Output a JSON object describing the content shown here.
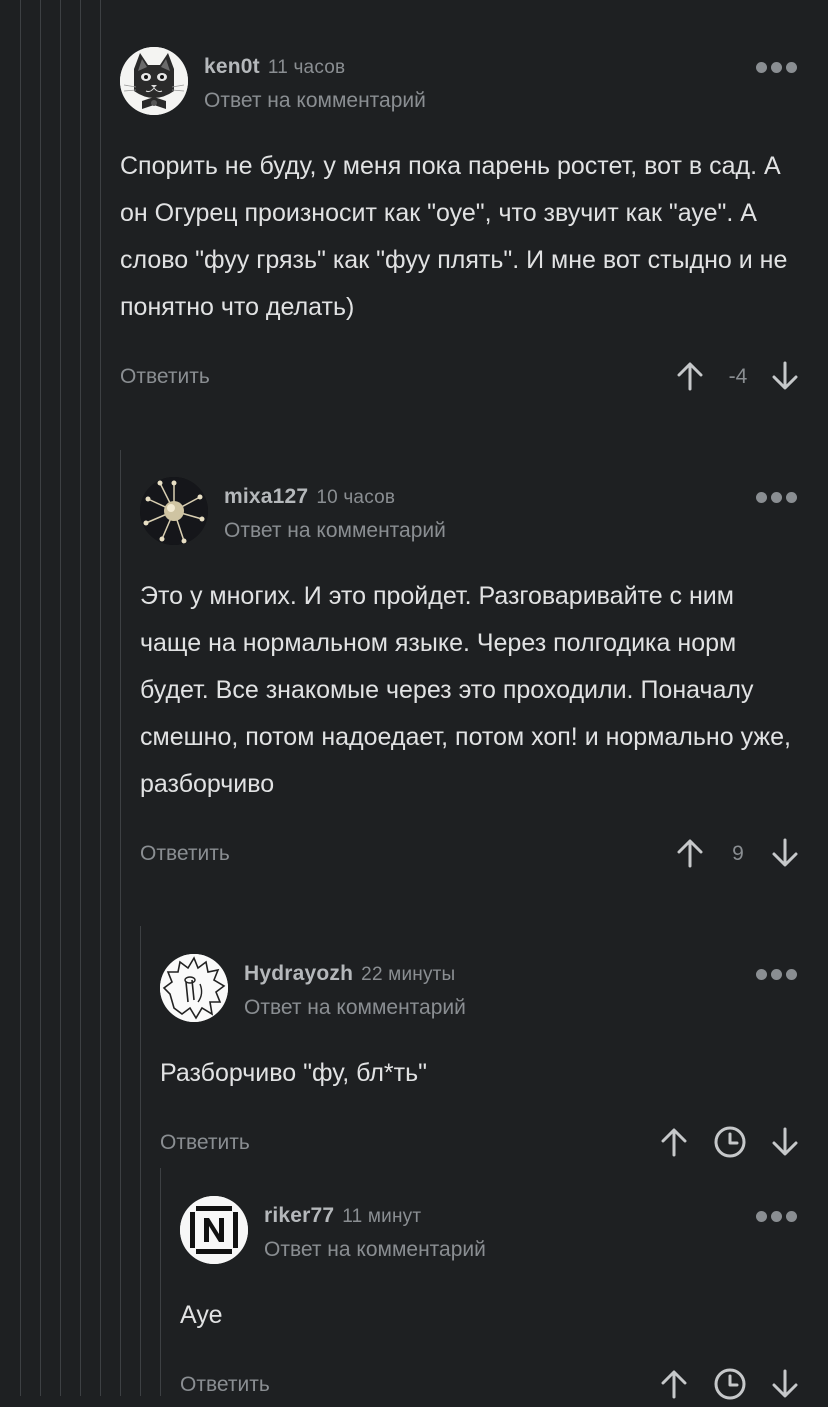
{
  "comments": [
    {
      "username": "ken0t",
      "time": "11 часов",
      "reply_to": "Ответ на комментарий",
      "text": "Спорить не буду, у меня пока парень ростет, вот в сад. А он Огурец произносит как \"оуе\", что звучит как \"ауе\". А слово  \"фуу грязь\" как \"фуу плять\". И мне вот стыдно и не понятно что делать)",
      "reply_label": "Ответить",
      "score": "-4",
      "avatar_icon": "cat-avatar-icon"
    },
    {
      "username": "mixa127",
      "time": "10 часов",
      "reply_to": "Ответ на комментарий",
      "text": "Это у многих. И это пройдет. Разговаривайте с ним чаще на нормальном языке. Через полгодика норм будет. Все знакомые через это проходили. Поначалу смешно, потом надоедает, потом хоп! и нормально уже, разборчиво",
      "reply_label": "Ответить",
      "score": "9",
      "avatar_icon": "virus-avatar-icon"
    },
    {
      "username": "Hydrayozh",
      "time": "22 минуты",
      "reply_to": "Ответ на комментарий",
      "text": "Разборчиво \"фу, бл*ть\"",
      "reply_label": "Ответить",
      "score_icon": "clock-icon",
      "avatar_icon": "hedgehog-avatar-icon"
    },
    {
      "username": "riker77",
      "time": "11 минут",
      "reply_to": "Ответ на комментарий",
      "text": "Ауе",
      "reply_label": "Ответить",
      "score_icon": "clock-icon",
      "avatar_icon": "rammstein-logo-avatar-icon"
    }
  ],
  "colors": {
    "background": "#1e2022",
    "text": "#e1e2e3",
    "muted": "#8a8e92",
    "thread_line": "#3d4043"
  }
}
